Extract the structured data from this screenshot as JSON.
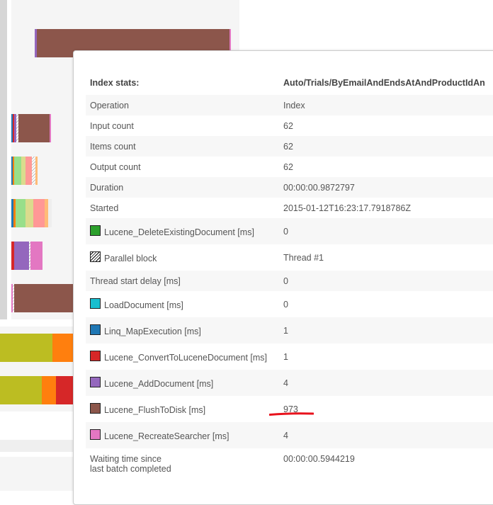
{
  "popup": {
    "header": {
      "label": "Index stats:",
      "value": "Auto/Trials/ByEmailAndEndsAtAndProductIdAn"
    },
    "rows": [
      {
        "label": "Operation",
        "value": "Index"
      },
      {
        "label": "Input count",
        "value": "62"
      },
      {
        "label": "Items count",
        "value": "62"
      },
      {
        "label": "Output count",
        "value": "62"
      },
      {
        "label": "Duration",
        "value": "00:00:00.9872797"
      },
      {
        "label": "Started",
        "value": "2015-01-12T16:23:17.7918786Z"
      },
      {
        "label": "Lucene_DeleteExistingDocument [ms]",
        "value": "0",
        "color": "#2ca02c"
      },
      {
        "label": "Parallel block",
        "value": "Thread #1",
        "color": "hatch"
      },
      {
        "label": "Thread start delay [ms]",
        "value": "0"
      },
      {
        "label": "LoadDocument [ms]",
        "value": "0",
        "color": "#17becf"
      },
      {
        "label": "Linq_MapExecution [ms]",
        "value": "1",
        "color": "#1f77b4"
      },
      {
        "label": "Lucene_ConvertToLuceneDocument [ms]",
        "value": "1",
        "color": "#d62728"
      },
      {
        "label": "Lucene_AddDocument [ms]",
        "value": "4",
        "color": "#9467bd"
      },
      {
        "label": "Lucene_FlushToDisk [ms]",
        "value": "973",
        "color": "#8c564b"
      },
      {
        "label": "Lucene_RecreateSearcher [ms]",
        "value": "4",
        "color": "#e377c2"
      },
      {
        "label": "Waiting time since",
        "label2": "last batch completed",
        "value": "00:00:00.5944219"
      }
    ]
  },
  "highlight_color": "#e8121c"
}
